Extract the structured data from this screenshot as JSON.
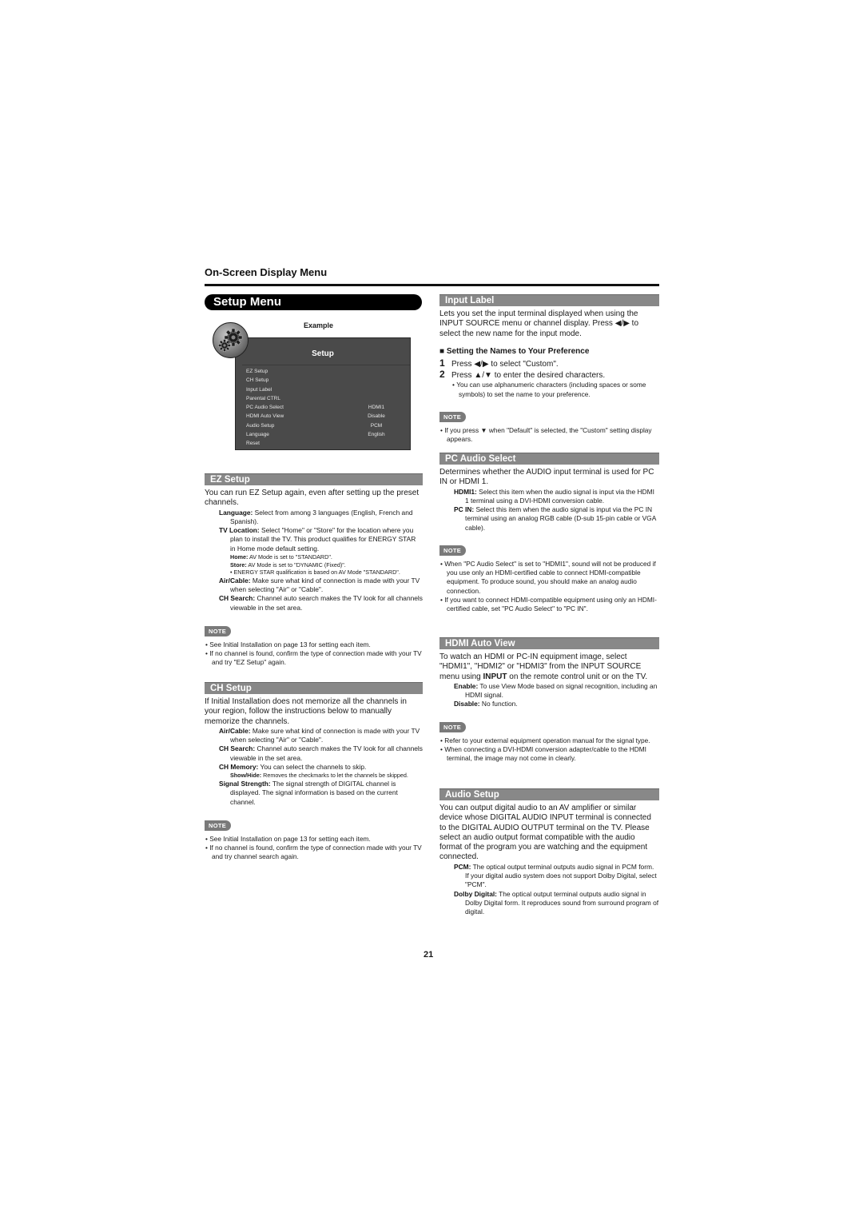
{
  "header": {
    "title": "On-Screen Display Menu"
  },
  "setup_menu": {
    "title": "Setup Menu",
    "example_label": "Example",
    "osd": {
      "icon": "gears-icon",
      "title": "Setup",
      "rows": [
        {
          "label": "EZ Setup",
          "value": ""
        },
        {
          "label": "CH Setup",
          "value": ""
        },
        {
          "label": "Input Label",
          "value": ""
        },
        {
          "label": "Parental CTRL",
          "value": ""
        },
        {
          "label": "PC Audio Select",
          "value": "HDMI1"
        },
        {
          "label": "HDMI Auto View",
          "value": "Disable"
        },
        {
          "label": "Audio Setup",
          "value": "PCM"
        },
        {
          "label": "Language",
          "value": "English"
        },
        {
          "label": "Reset",
          "value": ""
        }
      ]
    }
  },
  "ez_setup": {
    "title": "EZ Setup",
    "intro": "You can run EZ Setup again, even after setting up the preset channels.",
    "items": [
      {
        "term": "Language:",
        "desc": " Select from among 3 languages (English, French and Spanish)."
      },
      {
        "term": "TV Location:",
        "desc": " Select \"Home\" or \"Store\" for the location where you plan to install the TV. This product qualifies for ENERGY STAR in Home mode default setting."
      }
    ],
    "sub_items": [
      {
        "term": "Home:",
        "desc": " AV Mode is set to \"STANDARD\"."
      },
      {
        "term": "Store:",
        "desc": " AV Mode is set to \"DYNAMIC (Fixed)\"."
      }
    ],
    "sub_bullet": "ENERGY STAR qualification is based on AV Mode \"STANDARD\".",
    "items2": [
      {
        "term": "Air/Cable:",
        "desc": " Make sure what kind of connection is made with your TV when selecting \"Air\" or \"Cable\"."
      },
      {
        "term": "CH Search:",
        "desc": " Channel auto search makes the TV look for all channels viewable in the set area."
      }
    ],
    "note_label": "NOTE",
    "notes": [
      "See Initial Installation on page 13 for setting each item.",
      "If no channel is found, confirm the type of connection made with your TV and try \"EZ Setup\" again."
    ]
  },
  "ch_setup": {
    "title": "CH Setup",
    "intro": "If Initial Installation does not memorize all the channels in your region, follow the instructions below to manually memorize the channels.",
    "items": [
      {
        "term": "Air/Cable:",
        "desc": " Make sure what kind of connection is made with your TV when selecting \"Air\" or \"Cable\"."
      },
      {
        "term": "CH Search:",
        "desc": " Channel auto search makes the TV look for all channels viewable in the set area."
      },
      {
        "term": "CH Memory:",
        "desc": " You can select the channels to skip."
      }
    ],
    "sub_item": {
      "term": "Show/Hide:",
      "desc": " Removes the checkmarks to let the channels be skipped."
    },
    "items2": [
      {
        "term": "Signal Strength:",
        "desc": " The signal strength of DIGITAL channel is displayed. The signal information is based on the current channel."
      }
    ],
    "note_label": "NOTE",
    "notes": [
      "See Initial Installation on page 13 for setting each item.",
      "If no channel is found, confirm the type of connection made with your TV and try channel search again."
    ]
  },
  "input_label": {
    "title": "Input Label",
    "intro_pre": "Lets you set the input terminal displayed when using the INPUT SOURCE menu or channel display. Press ",
    "intro_keys": "◀/▶",
    "intro_post": " to select the new name for the input mode.",
    "subheading": "Setting the Names to Your Preference",
    "steps": [
      {
        "num": "1",
        "pre": "Press ",
        "keys": "◀/▶",
        "post": " to select \"Custom\"."
      },
      {
        "num": "2",
        "pre": "Press ",
        "keys": "▲/▼",
        "post": " to enter the desired characters."
      }
    ],
    "step_bullet": "You can use alphanumeric characters (including spaces or some symbols) to set the name to your preference.",
    "note_label": "NOTE",
    "notes": [
      "If you press ▼ when \"Default\" is selected, the \"Custom\" setting display appears."
    ]
  },
  "pc_audio_select": {
    "title": "PC Audio Select",
    "intro": "Determines whether the AUDIO input terminal is used for PC IN or HDMI 1.",
    "items": [
      {
        "term": "HDMI1:",
        "desc": " Select this item when the audio signal is input via the HDMI 1 terminal using a DVI-HDMI conversion cable."
      },
      {
        "term": "PC IN:",
        "desc": " Select this item when the audio signal is input via the PC IN terminal using an analog RGB cable (D-sub 15-pin cable or VGA cable)."
      }
    ],
    "note_label": "NOTE",
    "notes": [
      "When \"PC Audio Select\" is set to \"HDMI1\", sound will not be produced if you use only an HDMI-certified cable to connect HDMI-compatible equipment. To produce sound, you should make an analog audio connection.",
      "If you want to connect HDMI-compatible equipment using only an HDMI-certified cable, set \"PC Audio Select\" to \"PC IN\"."
    ]
  },
  "hdmi_auto_view": {
    "title": "HDMI Auto View",
    "intro_pre": "To watch an HDMI or PC-IN equipment image, select \"HDMI1\", \"HDMI2\" or \"HDMI3\" from the INPUT SOURCE menu using ",
    "intro_bold": "INPUT",
    "intro_post": " on the remote control unit or on the TV.",
    "items": [
      {
        "term": "Enable:",
        "desc": " To use View Mode based on signal recognition, including an HDMI signal."
      },
      {
        "term": "Disable:",
        "desc": " No function."
      }
    ],
    "note_label": "NOTE",
    "notes": [
      "Refer to your external equipment operation manual for the signal type.",
      "When connecting a DVI-HDMI conversion adapter/cable to the HDMI terminal, the image may not come in clearly."
    ]
  },
  "audio_setup": {
    "title": "Audio Setup",
    "intro": "You can output digital audio to an AV amplifier or similar device whose DIGITAL AUDIO INPUT terminal is connected to the DIGITAL AUDIO OUTPUT terminal on the TV. Please select an audio output format compatible with the audio format of the program you are watching and the equipment connected.",
    "items": [
      {
        "term": "PCM:",
        "desc": " The optical output terminal outputs audio signal in PCM form. If your digital audio system does not support Dolby Digital, select \"PCM\"."
      },
      {
        "term": "Dolby Digital:",
        "desc": " The optical output terminal outputs audio signal in Dolby Digital form. It reproduces sound from surround program of digital."
      }
    ]
  },
  "footer": {
    "page_number": "21"
  }
}
